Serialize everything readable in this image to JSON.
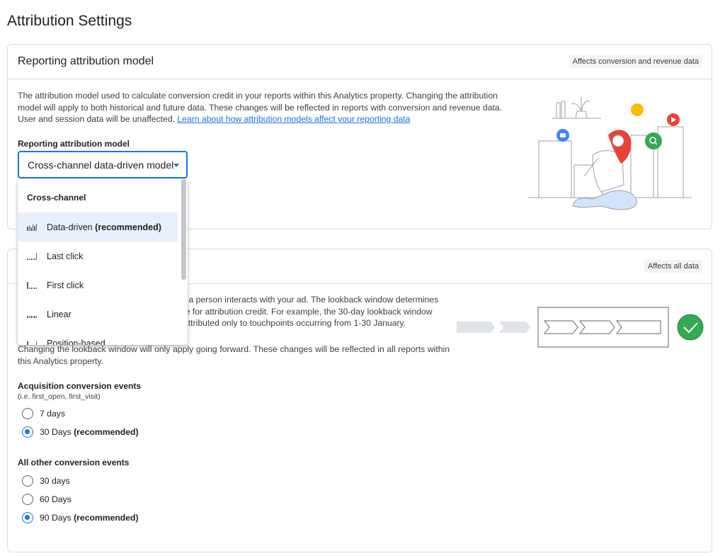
{
  "page": {
    "title": "Attribution Settings"
  },
  "reporting": {
    "title": "Reporting attribution model",
    "chip": "Affects conversion and revenue data",
    "description": "The attribution model used to calculate conversion credit in your reports within this Analytics property. Changing the attribution model will apply to both historical and future data. These changes will be reflected in reports with conversion and revenue data. User and session data will be unaffected.",
    "link": "Learn about how attribution models affect your reporting data",
    "field_label": "Reporting attribution model",
    "selected_value": "Cross-channel data-driven model"
  },
  "dropdown": {
    "group": "Cross-channel",
    "items": [
      {
        "label": "Data-driven",
        "suffix": "(recommended)",
        "icon": "bar-chart-icon",
        "selected": true
      },
      {
        "label": "Last click",
        "suffix": "",
        "icon": "last-click-icon",
        "selected": false
      },
      {
        "label": "First click",
        "suffix": "",
        "icon": "first-click-icon",
        "selected": false
      },
      {
        "label": "Linear",
        "suffix": "",
        "icon": "linear-icon",
        "selected": false
      },
      {
        "label": "Position-based",
        "suffix": "",
        "icon": "position-icon",
        "selected": false
      }
    ]
  },
  "lookback": {
    "chip": "Affects all data",
    "description_visible": "r a person interacts with your ad. The lookback window determines",
    "description_line2": "le for attribution credit. For example, the 30-day lookback window",
    "description_line3": "attributed only to touchpoints occurring from 1-30 January.",
    "description_line4": "Changing the lookback window will only apply going forward. These changes will be reflected in all reports within this Analytics property.",
    "acquisition": {
      "heading": "Acquisition conversion events",
      "note": "(i.e. first_open, first_visit)",
      "options": [
        {
          "label": "7 days",
          "suffix": "",
          "checked": false
        },
        {
          "label": "30 Days",
          "suffix": "(recommended)",
          "checked": true
        }
      ]
    },
    "other": {
      "heading": "All other conversion events",
      "options": [
        {
          "label": "30 days",
          "suffix": "",
          "checked": false
        },
        {
          "label": "60 Days",
          "suffix": "",
          "checked": false
        },
        {
          "label": "90 Days",
          "suffix": "(recommended)",
          "checked": true
        }
      ]
    }
  },
  "colors": {
    "accent": "#1a73e8",
    "green": "#34a853",
    "red": "#ea4335",
    "yellow": "#fbbc04"
  }
}
